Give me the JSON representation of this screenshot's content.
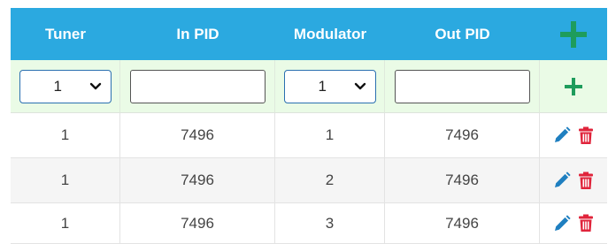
{
  "header": {
    "columns": [
      "Tuner",
      "In PID",
      "Modulator",
      "Out PID"
    ],
    "add_icon": "plus-icon"
  },
  "add_row": {
    "tuner_select": "1",
    "in_pid_value": "",
    "modulator_select": "1",
    "out_pid_value": "",
    "add_icon": "plus-icon"
  },
  "rows": [
    {
      "tuner": "1",
      "in_pid": "7496",
      "modulator": "1",
      "out_pid": "7496"
    },
    {
      "tuner": "1",
      "in_pid": "7496",
      "modulator": "2",
      "out_pid": "7496"
    },
    {
      "tuner": "1",
      "in_pid": "7496",
      "modulator": "3",
      "out_pid": "7496"
    }
  ],
  "row_actions": [
    "pencil-icon",
    "trash-icon"
  ],
  "colors": {
    "header_bg": "#2ba9e0",
    "add_row_bg": "#eafbe6",
    "plus_green": "#1e9c5c",
    "edit_blue": "#1f7fc0",
    "delete_red": "#e0243b",
    "select_border": "#2a6fb0"
  }
}
